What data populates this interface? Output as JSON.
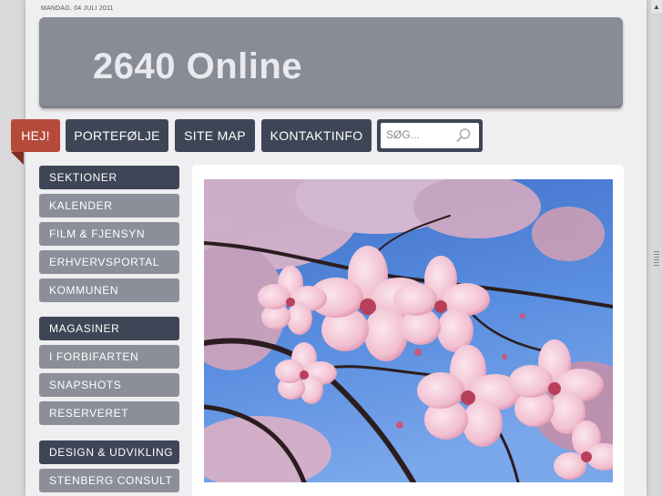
{
  "date": "MANDAG, 04 JULI 2011",
  "site": {
    "title": "2640 Online"
  },
  "nav": {
    "items": [
      {
        "label": "HEJ!",
        "active": true
      },
      {
        "label": "PORTEFØLJE",
        "active": false
      },
      {
        "label": "SITE MAP",
        "active": false
      },
      {
        "label": "KONTAKTINFO",
        "active": false
      }
    ]
  },
  "search": {
    "placeholder": "SØG...",
    "icon": "search-icon"
  },
  "sidebar": {
    "sections": [
      {
        "heading": "SEKTIONER",
        "items": [
          "KALENDER",
          "FILM & FJENSYN",
          "ERHVERVSPORTAL",
          "KOMMUNEN"
        ]
      },
      {
        "heading": "MAGASINER",
        "items": [
          "I FORBIFARTEN",
          "SNAPSHOTS",
          "RESERVERET"
        ]
      },
      {
        "heading": "DESIGN & UDVIKLING",
        "items": [
          "STENBERG CONSULT"
        ]
      }
    ]
  },
  "colors": {
    "nav": "#3e4556",
    "nav_active": "#b54a3b",
    "sidebar_link": "#8c8f99",
    "header": "#878c97"
  }
}
